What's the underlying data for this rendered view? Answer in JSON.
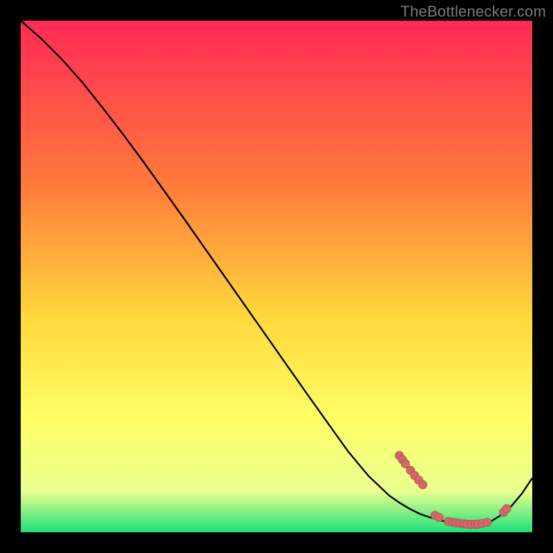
{
  "watermark": "TheBottlenecker.com",
  "colors": {
    "bg": "#000000",
    "grad_top": "#ff2a55",
    "grad_mid1": "#ff7a3c",
    "grad_mid2": "#ffd83c",
    "grad_mid3": "#ffff66",
    "grad_mid4": "#e9ff8f",
    "grad_bottom": "#1fe07a",
    "curve": "#000000",
    "dot_fill": "#cf6a6a",
    "dot_stroke": "#b94f4f"
  },
  "chart_data": {
    "type": "line",
    "title": "",
    "xlabel": "",
    "ylabel": "",
    "xlim": [
      0,
      100
    ],
    "ylim": [
      0,
      100
    ],
    "grid": false,
    "series": [
      {
        "name": "bottleneck-curve",
        "x": [
          0,
          4,
          8,
          12,
          16,
          20,
          24,
          28,
          32,
          36,
          40,
          44,
          48,
          52,
          56,
          60,
          64,
          68,
          72,
          74,
          76,
          78,
          80,
          82,
          84,
          86,
          88,
          90,
          92,
          94,
          96,
          98,
          100
        ],
        "y": [
          100,
          96.5,
          92.5,
          88,
          83,
          77.8,
          72.4,
          66.8,
          61.2,
          55.5,
          49.8,
          44.1,
          38.4,
          32.7,
          27,
          21.4,
          15.8,
          11,
          7.2,
          5.8,
          4.6,
          3.6,
          2.9,
          2.3,
          1.9,
          1.6,
          1.5,
          1.6,
          2.2,
          3.4,
          5.2,
          7.6,
          10.6
        ]
      }
    ],
    "dot_clusters": [
      {
        "name": "descent-cluster",
        "points": [
          {
            "x": 74.0,
            "y": 15.0
          },
          {
            "x": 74.6,
            "y": 14.2
          },
          {
            "x": 75.2,
            "y": 13.4
          },
          {
            "x": 76.2,
            "y": 12.1
          },
          {
            "x": 77.0,
            "y": 11.1
          },
          {
            "x": 77.8,
            "y": 10.2
          },
          {
            "x": 78.6,
            "y": 9.3
          }
        ]
      },
      {
        "name": "valley-left-pair",
        "points": [
          {
            "x": 81.0,
            "y": 3.3
          },
          {
            "x": 81.8,
            "y": 2.9
          }
        ]
      },
      {
        "name": "valley-run",
        "points": [
          {
            "x": 83.6,
            "y": 2.1
          },
          {
            "x": 84.4,
            "y": 1.95
          },
          {
            "x": 85.0,
            "y": 1.85
          },
          {
            "x": 85.8,
            "y": 1.75
          },
          {
            "x": 86.6,
            "y": 1.65
          },
          {
            "x": 87.2,
            "y": 1.58
          },
          {
            "x": 88.0,
            "y": 1.55
          },
          {
            "x": 88.8,
            "y": 1.55
          },
          {
            "x": 89.4,
            "y": 1.6
          },
          {
            "x": 90.2,
            "y": 1.7
          }
        ]
      },
      {
        "name": "valley-right",
        "points": [
          {
            "x": 91.2,
            "y": 1.95
          }
        ]
      },
      {
        "name": "ascent-pair",
        "points": [
          {
            "x": 94.4,
            "y": 3.9
          },
          {
            "x": 95.0,
            "y": 4.6
          }
        ]
      }
    ]
  }
}
